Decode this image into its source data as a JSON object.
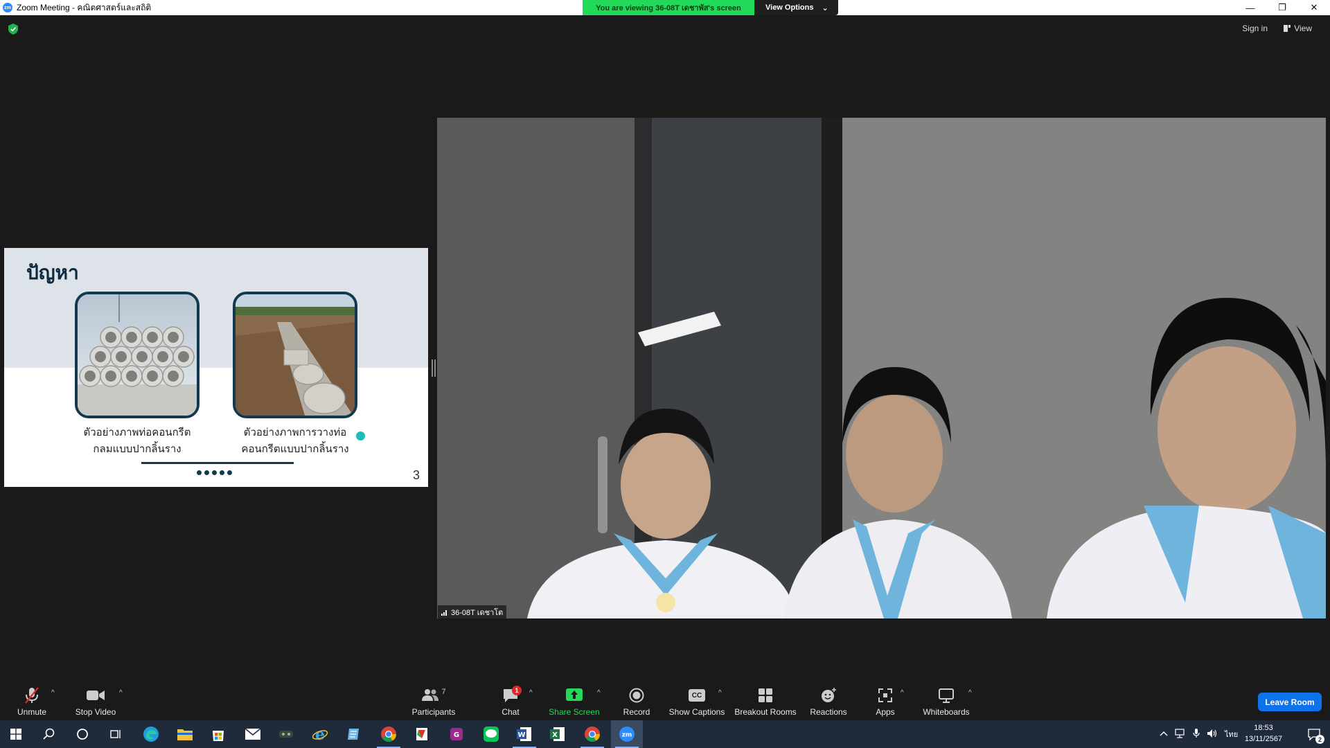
{
  "window": {
    "logo": "zm",
    "title": "Zoom Meeting - คณิตศาสตร์และสถิติ",
    "controls": {
      "minimize": "—",
      "restore": "❐",
      "close": "✕"
    }
  },
  "banner": {
    "viewing_text": "You are viewing 36-08T เดชาพัส's screen",
    "view_options_label": "View Options",
    "caret": "⌄"
  },
  "topbar": {
    "sign_in": "Sign in",
    "view": "View"
  },
  "slide": {
    "title": "ปัญหา",
    "caption1_line1": "ตัวอย่างภาพท่อคอนกรีต",
    "caption1_line2": "กลมแบบปากลิ้นราง",
    "caption2_line1": "ตัวอย่างภาพการวางท่อ",
    "caption2_line2": "คอนกรีตแบบปากลิ้นราง",
    "page_number": "3",
    "accent_color": "#12394d",
    "dot_color": "#1bbfb8"
  },
  "video": {
    "participant_label": "36-08T เดชาโต"
  },
  "toolbar": {
    "unmute": "Unmute",
    "stop_video": "Stop Video",
    "participants": "Participants",
    "participants_count": "7",
    "chat": "Chat",
    "chat_badge": "1",
    "share_screen": "Share Screen",
    "record": "Record",
    "show_captions": "Show Captions",
    "captions_icon_text": "CC",
    "breakout_rooms": "Breakout Rooms",
    "reactions": "Reactions",
    "apps": "Apps",
    "whiteboards": "Whiteboards",
    "leave_room": "Leave Room",
    "caret": "^",
    "share_color": "#23d959",
    "leave_color": "#0e72ed"
  },
  "taskbar": {
    "language": "ไทย",
    "time": "18:53",
    "date": "13/11/2567",
    "notification_count": "2"
  }
}
